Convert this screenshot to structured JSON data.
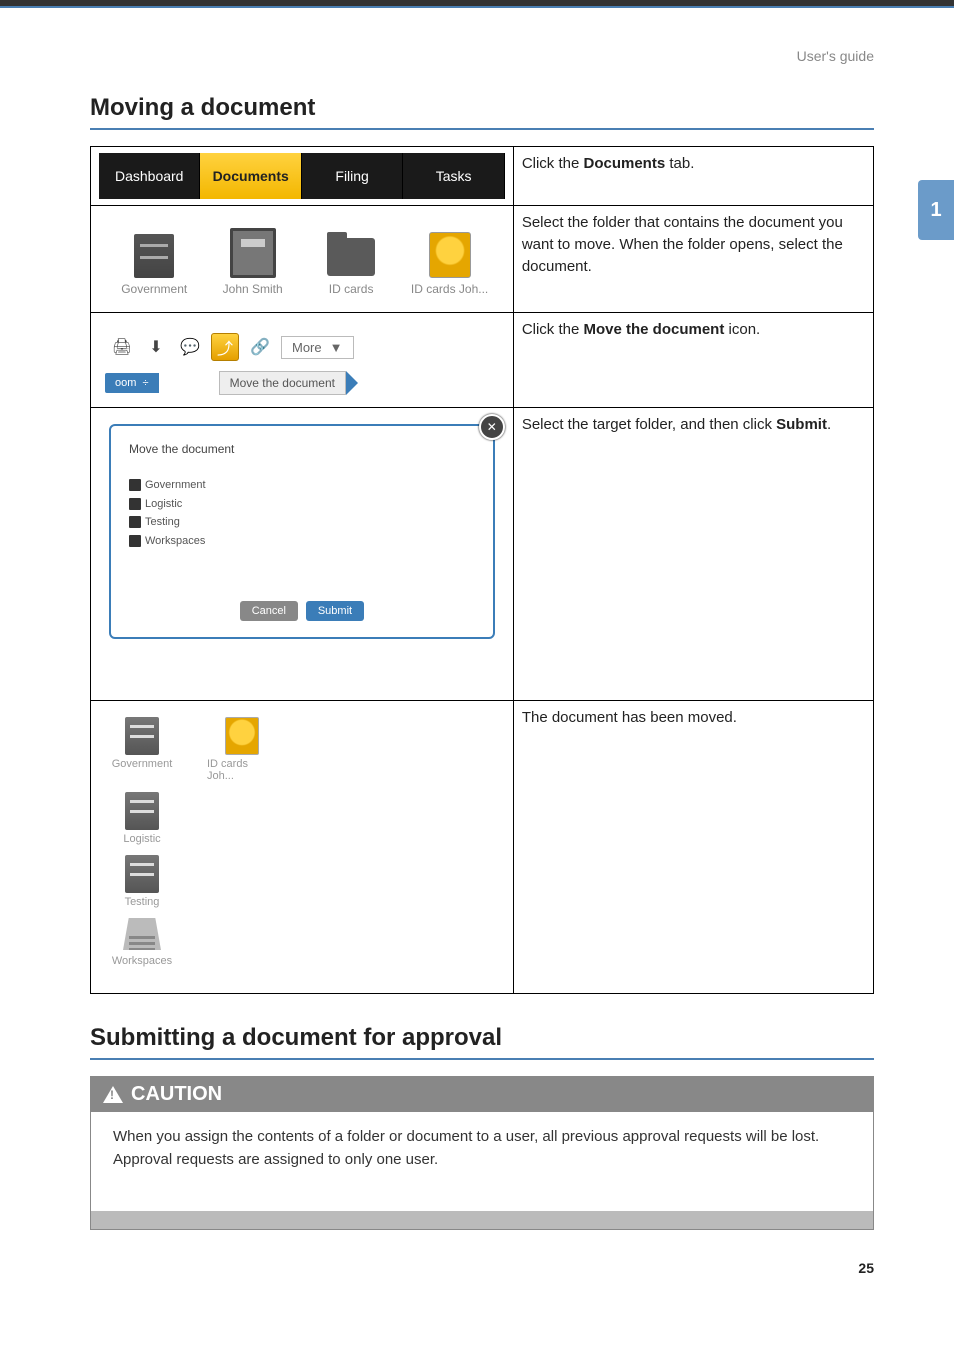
{
  "header": {
    "doc_title": "User's guide"
  },
  "side_tab": {
    "label": "1"
  },
  "section1": {
    "title": "Moving a document"
  },
  "section2": {
    "title": "Submitting a document for approval"
  },
  "tabs": {
    "dashboard": "Dashboard",
    "documents": "Documents",
    "filing": "Filing",
    "tasks": "Tasks"
  },
  "folders": {
    "government": "Government",
    "john_smith": "John Smith",
    "id_cards": "ID cards",
    "id_cards_joh": "ID cards Joh..."
  },
  "toolbar": {
    "more": "More",
    "dropdown_glyph": "▼",
    "zoom_label": "oom",
    "zoom_symbol": "÷",
    "tooltip": "Move the document"
  },
  "modal": {
    "title": "Move the document",
    "tree": {
      "government": "Government",
      "logistic": "Logistic",
      "testing": "Testing",
      "workspaces": "Workspaces"
    },
    "cancel": "Cancel",
    "submit": "Submit"
  },
  "results": {
    "government": "Government",
    "id_cards_joh": "ID cards Joh...",
    "logistic": "Logistic",
    "testing": "Testing",
    "workspaces": "Workspaces"
  },
  "descriptions": {
    "row1_pre": "Click the ",
    "row1_bold": "Documents",
    "row1_post": " tab.",
    "row2": "Select the folder that contains the document you want to move. When the folder opens, select the document.",
    "row3_pre": "Click the ",
    "row3_bold": "Move the document",
    "row3_post": " icon.",
    "row4_pre": "Select the target folder, and then click ",
    "row4_bold": "Submit",
    "row4_post": ".",
    "row5": "The document has been moved."
  },
  "caution": {
    "label": "CAUTION",
    "body": "When you assign the contents of a folder or document to a user, all previous approval requests will be lost. Approval requests are assigned to only one user."
  },
  "page_number": "25"
}
